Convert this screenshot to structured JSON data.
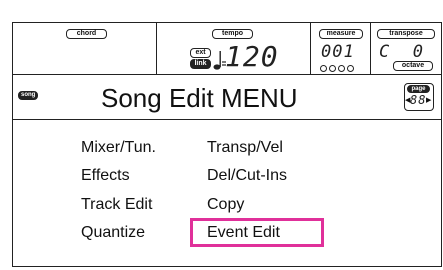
{
  "header": {
    "chord_label": "chord",
    "tempo_label": "tempo",
    "tempo_ext": "ext",
    "tempo_link": "link",
    "tempo_value": "120",
    "measure_label": "measure",
    "measure_value": "001",
    "transpose_label": "transpose",
    "transpose_value": "C  0",
    "octave_label": "octave"
  },
  "title": {
    "song_badge": "song",
    "text": "Song Edit MENU",
    "page_label": "page",
    "page_value": "88"
  },
  "menu": {
    "left": [
      "Mixer/Tun.",
      "Effects",
      "Track Edit",
      "Quantize"
    ],
    "right": [
      "Transp/Vel",
      "Del/Cut-Ins",
      "Copy",
      "Event Edit"
    ],
    "highlight_color": "#e0309a"
  }
}
